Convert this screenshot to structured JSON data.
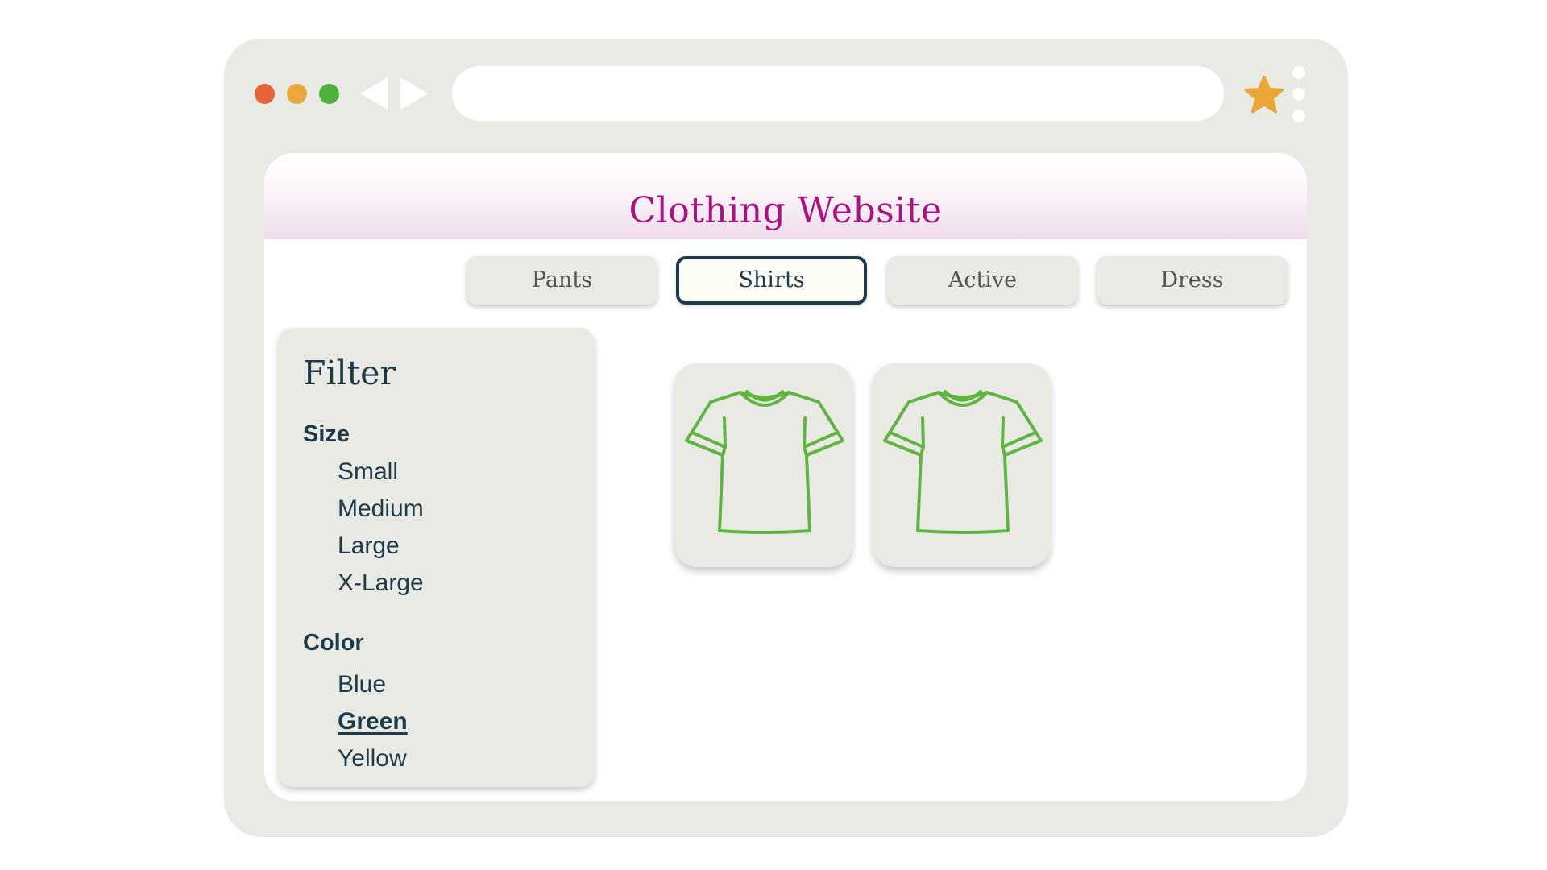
{
  "window": {
    "controls": [
      {
        "name": "close",
        "color": "#e8623a"
      },
      {
        "name": "minimize",
        "color": "#e8a83a"
      },
      {
        "name": "maximize",
        "color": "#4fb13b"
      }
    ],
    "nav_icons": [
      "back-arrow-icon",
      "forward-arrow-icon"
    ],
    "address_bar": {
      "value": "",
      "placeholder": ""
    },
    "bookmark_icon": "star-icon",
    "menu_icon": "kebab-menu-icon",
    "bookmark_color": "#eaa637"
  },
  "site": {
    "title": "Clothing Website",
    "title_color": "#a5177f"
  },
  "tabs": [
    {
      "label": "Pants",
      "active": false
    },
    {
      "label": "Shirts",
      "active": true
    },
    {
      "label": "Active",
      "active": false
    },
    {
      "label": "Dress",
      "active": false
    }
  ],
  "filter": {
    "title": "Filter",
    "size": {
      "heading": "Size",
      "options": [
        "Small",
        "Medium",
        "Large",
        "X-Large"
      ]
    },
    "color": {
      "heading": "Color",
      "options": [
        "Blue",
        "Green",
        "Yellow"
      ],
      "selected": "Green"
    }
  },
  "products": [
    {
      "icon": "t-shirt-icon",
      "color": "#5fb443"
    },
    {
      "icon": "t-shirt-icon",
      "color": "#5fb443"
    }
  ]
}
